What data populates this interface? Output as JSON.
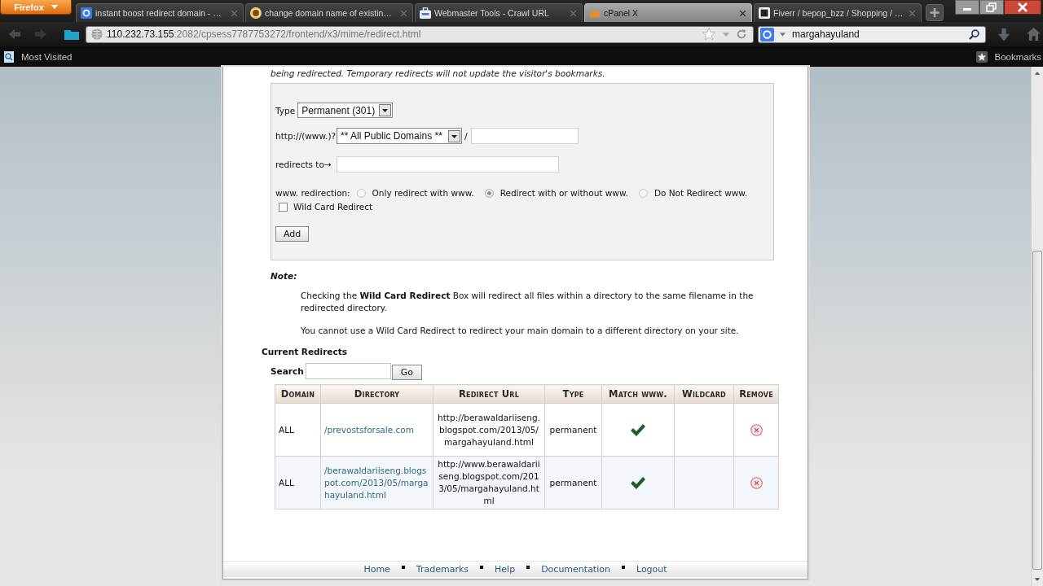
{
  "browser": {
    "menu_button": "Firefox",
    "tabs": [
      {
        "title": "instant boost redirect domain - …",
        "selected": false
      },
      {
        "title": "change domain name of existin…",
        "selected": false
      },
      {
        "title": "Webmaster Tools - Crawl URL",
        "selected": false
      },
      {
        "title": "cPanel X",
        "selected": true
      },
      {
        "title": "Fiverr / bepop_bzz / Shopping / …",
        "selected": false
      }
    ],
    "address": {
      "host": "110.232.73.155",
      "path": ":2082/cpsess7787753272/frontend/x3/mime/redirect.html"
    },
    "search": {
      "value": "margahayuland"
    },
    "bookmarks_bar": {
      "most_visited": "Most Visited",
      "bookmarks": "Bookmarks"
    }
  },
  "page": {
    "intro": "being redirected. Temporary redirects will not update the visitor's bookmarks.",
    "form": {
      "type_label": "Type",
      "type_value": "Permanent (301)",
      "domain_label": "http://(www.)?",
      "domain_value": "** All Public Domains **",
      "path_separator": "/",
      "redirects_label": "redirects to→",
      "www_label": "www. redirection:",
      "www_options": [
        {
          "label": "Only redirect with www.",
          "selected": false
        },
        {
          "label": "Redirect with or without www.",
          "selected": true
        },
        {
          "label": "Do Not Redirect www.",
          "selected": false
        }
      ],
      "wildcard": {
        "label": "Wild Card Redirect",
        "checked": false
      },
      "add_button": "Add"
    },
    "note": {
      "title": "Note:",
      "paragraphs": [
        "Checking the **Wild Card Redirect** Box will redirect all files within a directory to the same filename in the redirected directory.",
        "You cannot use a Wild Card Redirect to redirect your main domain to a different directory on your site."
      ]
    },
    "current_redirects": {
      "title": "Current Redirects",
      "search_label": "Search",
      "go_button": "Go",
      "columns": [
        "Domain",
        "Directory",
        "Redirect Url",
        "Type",
        "Match www.",
        "Wildcard",
        "Remove"
      ],
      "rows": [
        {
          "domain": "ALL",
          "directory": "/prevostsforsale.com",
          "redirect_url": "http://berawaldariiseng.blogspot.com/2013/05/margahayuland.html",
          "type": "permanent",
          "match_www": true,
          "wildcard": false
        },
        {
          "domain": "ALL",
          "directory": "/berawaldariiseng.blogspot.com/2013/05/margahayuland.html",
          "redirect_url": "http://www.berawaldariiseng.blogspot.com/2013/05/margahayuland.html",
          "type": "permanent",
          "match_www": true,
          "wildcard": false
        }
      ]
    },
    "footer_links": [
      "Home",
      "Trademarks",
      "Help",
      "Documentation",
      "Logout"
    ]
  }
}
